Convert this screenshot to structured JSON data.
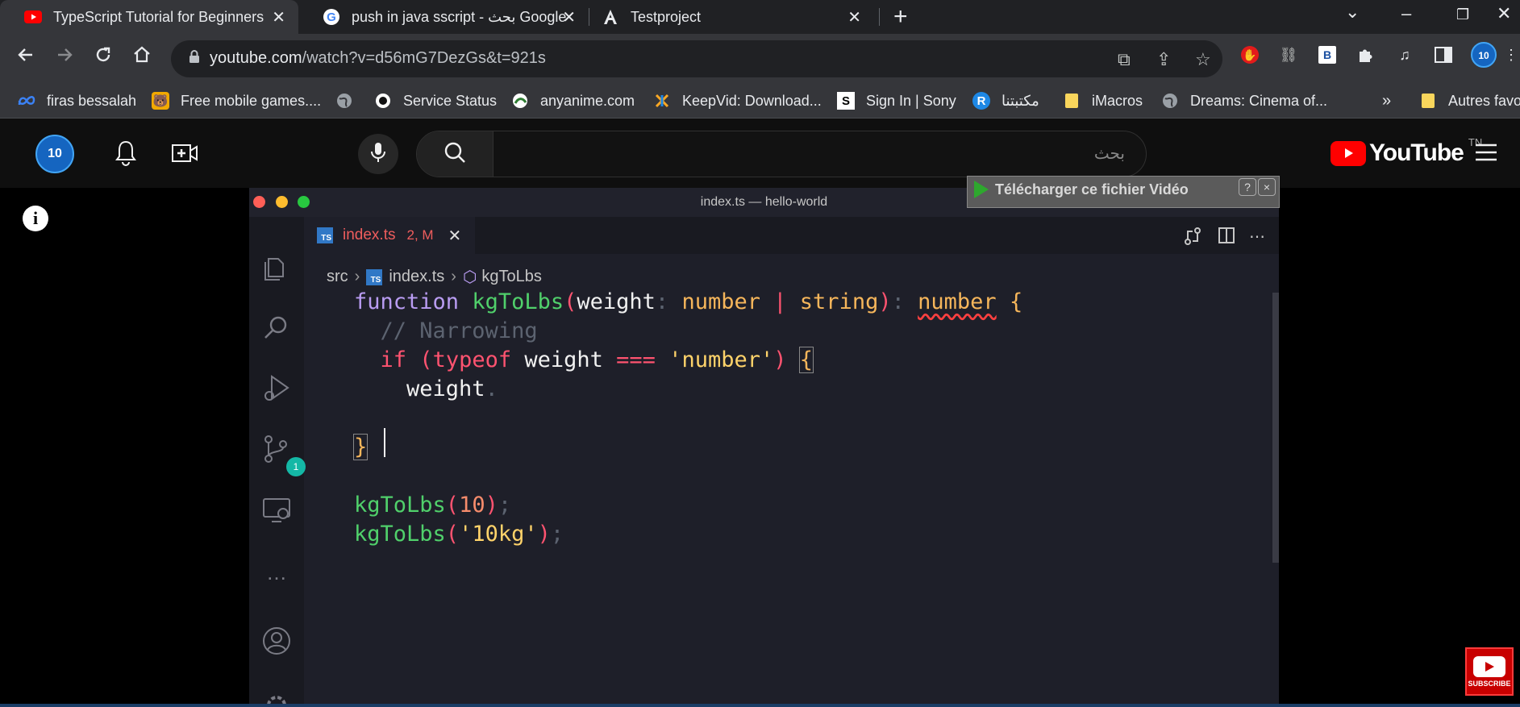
{
  "browser": {
    "tabs": [
      {
        "title": "TypeScript Tutorial for Beginners",
        "favicon": "youtube-icon",
        "active": true
      },
      {
        "title": "push in java sscript - بحث Google",
        "favicon": "google-icon",
        "active": false
      },
      {
        "title": "Testproject",
        "favicon": "angular-icon",
        "active": false
      }
    ],
    "new_tab": "+",
    "url_host": "youtube.com",
    "url_path": "/watch?v=d56mG7DezGs&t=921s",
    "bookmarks": [
      {
        "label": "firas bessalah",
        "icon": "meta-icon"
      },
      {
        "label": "Free mobile games....",
        "icon": "game-icon"
      },
      {
        "label": "",
        "icon": "globe-icon"
      },
      {
        "label": "Service Status",
        "icon": "status-icon"
      },
      {
        "label": "anyanime.com",
        "icon": "anime-icon"
      },
      {
        "label": "KeepVid: Download...",
        "icon": "keepvid-icon"
      },
      {
        "label": "Sign In | Sony",
        "icon": "sony-icon"
      },
      {
        "label": "مكتبتنا",
        "icon": "library-icon"
      },
      {
        "label": "iMacros",
        "icon": "folder-icon"
      },
      {
        "label": "Dreams: Cinema of...",
        "icon": "globe-icon"
      }
    ],
    "bookmarks_more": "»",
    "other_bookmarks": "Autres favo"
  },
  "youtube": {
    "search_placeholder": "بحث",
    "logo_text": "YouTube",
    "country_code": "TN",
    "avatar_text": "10"
  },
  "vscode": {
    "window_title": "index.ts — hello-world",
    "tab_name": "index.ts",
    "tab_status": "2, M",
    "ts_badge": "TS",
    "scm_badge": "1",
    "breadcrumb": [
      "src",
      "index.ts",
      "kgToLbs"
    ],
    "code_lines": [
      "function kgToLbs(weight: number | string): number {",
      "  // Narrowing",
      "  if (typeof weight === 'number') {",
      "    weight.",
      "",
      "}",
      "",
      "kgToLbs(10);",
      "kgToLbs('10kg');"
    ]
  },
  "overlay": {
    "download_label": "Télécharger ce fichier Vidéo",
    "help": "?",
    "close": "×",
    "subscribe_label": "SUBSCRIBE"
  },
  "info_icon_text": "i"
}
